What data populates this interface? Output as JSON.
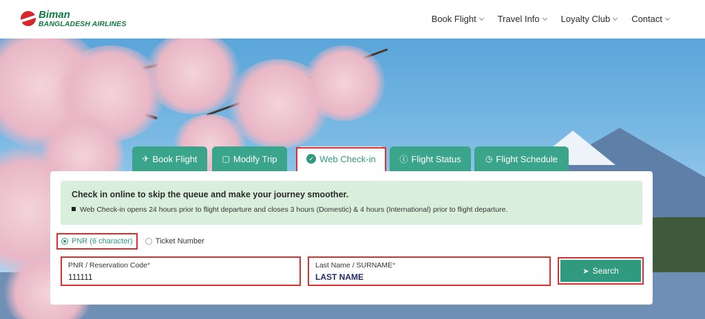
{
  "brand": {
    "name": "Biman",
    "subtitle": "BANGLADESH AIRLINES"
  },
  "nav": [
    {
      "label": "Book Flight"
    },
    {
      "label": "Travel Info"
    },
    {
      "label": "Loyalty Club"
    },
    {
      "label": "Contact"
    }
  ],
  "tabs": [
    {
      "label": "Book Flight",
      "icon": "plane-icon"
    },
    {
      "label": "Modify Trip",
      "icon": "clipboard-icon"
    },
    {
      "label": "Web Check-in",
      "icon": "check-circle-icon",
      "active": true
    },
    {
      "label": "Flight Status",
      "icon": "info-icon"
    },
    {
      "label": "Flight Schedule",
      "icon": "clock-icon"
    }
  ],
  "info": {
    "title": "Check in online to skip the queue and make your journey smoother.",
    "note": "Web Check-in opens 24 hours prior to flight departure and closes 3 hours (Domestic) & 4 hours (International) prior to flight departure."
  },
  "options": {
    "pnr": "PNR (6 character)",
    "ticket": "Ticket Number",
    "selected": "pnr"
  },
  "fields": {
    "pnr": {
      "label": "PNR / Reservation Code",
      "required": "*",
      "value": "111111"
    },
    "surname": {
      "label": "Last Name / SURNAME",
      "required": "*",
      "value": "LAST NAME"
    }
  },
  "search": {
    "label": "Search"
  },
  "colors": {
    "accent": "#2f9a7e",
    "highlight": "#d92f2f",
    "brand": "#0e7a3f",
    "info_bg": "#d9efdc"
  }
}
